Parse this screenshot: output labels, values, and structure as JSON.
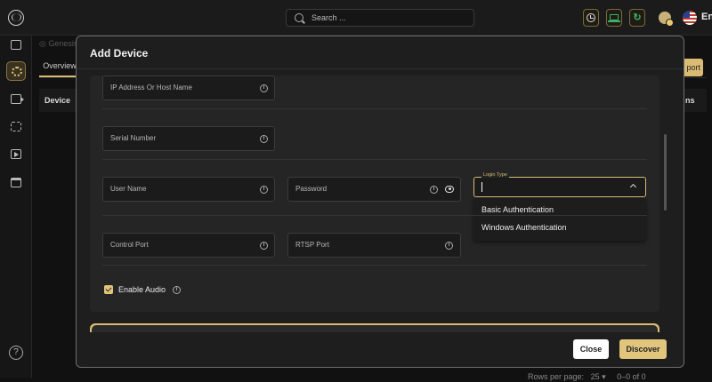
{
  "topbar": {
    "search_placeholder": "Search ...",
    "language": "En",
    "icons": [
      "clock-icon",
      "laptop-icon",
      "refresh-icon"
    ],
    "accent_color": "#d9bb73"
  },
  "sidebar": {
    "items": [
      "monitor-icon",
      "settings-icon",
      "camera-icon",
      "map-icon",
      "playback-icon",
      "bag-icon"
    ],
    "active_index": 1,
    "help_glyph": "?"
  },
  "background": {
    "breadcrumb": "Genesis",
    "tab": "Overview",
    "table_header_device": "Device",
    "table_header_actions": "ns",
    "export_label": "port",
    "rows_per_page_label": "Rows per page:",
    "rows_per_page_value": "25",
    "pagination": "0–0 of 0"
  },
  "modal": {
    "title": "Add Device",
    "fields": {
      "ip": "IP Address Or Host Name",
      "serial": "Serial Number",
      "username": "User Name",
      "password": "Password",
      "control_port": "Control Port",
      "rtsp_port": "RTSP Port"
    },
    "login_type": {
      "label": "Login Type",
      "value": "",
      "options": [
        "Basic Authentication",
        "Windows Authentication"
      ]
    },
    "enable_audio": {
      "label": "Enable Audio",
      "checked": true
    },
    "buttons": {
      "close": "Close",
      "discover": "Discover"
    }
  }
}
